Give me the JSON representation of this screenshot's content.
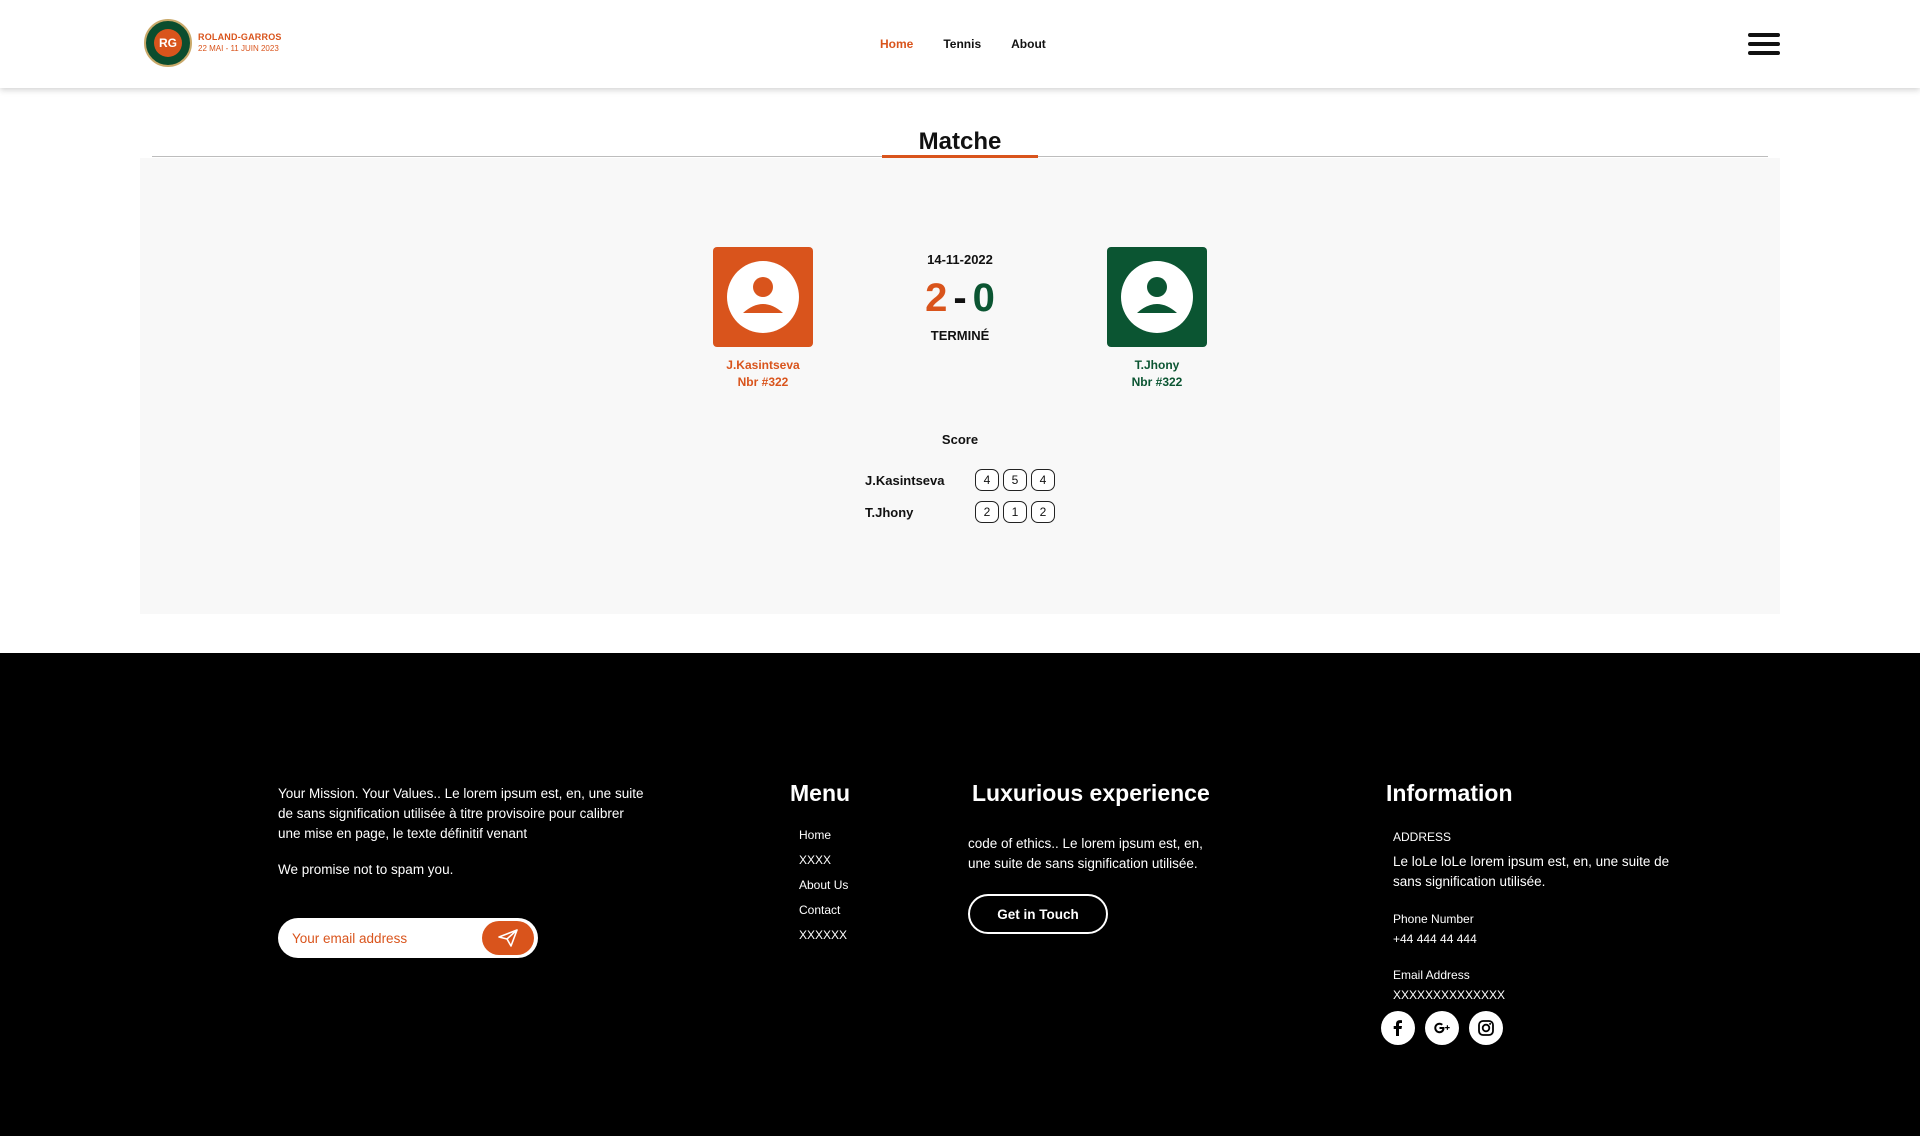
{
  "header": {
    "logo": {
      "name": "ROLAND-GARROS",
      "dates": "22 MAI - 11 JUIN 2023"
    },
    "nav": [
      {
        "label": "Home",
        "active": true
      },
      {
        "label": "Tennis",
        "active": false
      },
      {
        "label": "About",
        "active": false
      }
    ]
  },
  "page": {
    "title": "Matche"
  },
  "match": {
    "date": "14-11-2022",
    "status": "TERMINÉ",
    "score_home": "2",
    "score_sep": "-",
    "score_away": "0",
    "player1": {
      "name": "J.Kasintseva",
      "number": "Nbr #322",
      "color": "#d9541c"
    },
    "player2": {
      "name": "T.Jhony",
      "number": "Nbr #322",
      "color": "#0b5532"
    }
  },
  "score": {
    "title": "Score",
    "rows": [
      {
        "player": "J.Kasintseva",
        "sets": [
          "4",
          "5",
          "4"
        ]
      },
      {
        "player": "T.Jhony",
        "sets": [
          "2",
          "1",
          "2"
        ]
      }
    ]
  },
  "footer": {
    "mission": "Your Mission. Your Values.. Le lorem ipsum est, en, une suite de  sans signification utilisée à titre provisoire pour calibrer une mise en  page, le texte définitif venant",
    "promise": "We promise not to spam you.",
    "email_placeholder": "Your email address",
    "menu_title": "Menu",
    "menu_items": [
      "Home",
      "XXXX",
      "About Us",
      "Contact",
      "XXXXXX"
    ],
    "lux_title": "Luxurious experience",
    "lux_text": "code of ethics.. Le lorem ipsum est, en, une suite de  sans signification utilisée.",
    "touch_label": "Get in Touch",
    "info_title": "Information",
    "address_label": "ADDRESS",
    "address_text": "Le loLe loLe lorem ipsum est, en, une suite de  sans signification utilisée.",
    "phone_label": "Phone Number",
    "phone_value": "+44 444 44 444",
    "email_label": "Email Address",
    "email_value": "XXXXXXXXXXXXXX",
    "social": [
      "facebook-icon",
      "google-plus-icon",
      "instagram-icon"
    ]
  },
  "colors": {
    "accent": "#d9541c",
    "green": "#0b5532",
    "footer_bg": "#000000"
  }
}
